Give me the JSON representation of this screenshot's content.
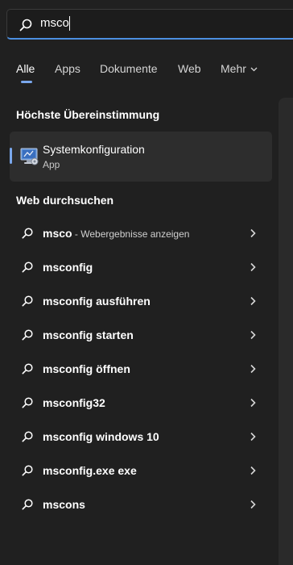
{
  "search": {
    "value": "msco"
  },
  "tabs": [
    {
      "label": "Alle",
      "active": true
    },
    {
      "label": "Apps"
    },
    {
      "label": "Dokumente"
    },
    {
      "label": "Web"
    },
    {
      "label": "Mehr"
    }
  ],
  "best_match": {
    "heading": "Höchste Übereinstimmung",
    "title": "Systemkonfiguration",
    "subtitle": "App"
  },
  "web": {
    "heading": "Web durchsuchen",
    "items": [
      {
        "label": "msco",
        "suffix": " - Webergebnisse anzeigen"
      },
      {
        "label": "msconfig"
      },
      {
        "label": "msconfig ausführen"
      },
      {
        "label": "msconfig starten"
      },
      {
        "label": "msconfig öffnen"
      },
      {
        "label": "msconfig32"
      },
      {
        "label": "msconfig windows 10"
      },
      {
        "label": "msconfig.exe exe"
      },
      {
        "label": "mscons"
      }
    ]
  },
  "colors": {
    "accent": "#7aa7ec",
    "background": "#202020",
    "card": "#2d2d2d"
  }
}
